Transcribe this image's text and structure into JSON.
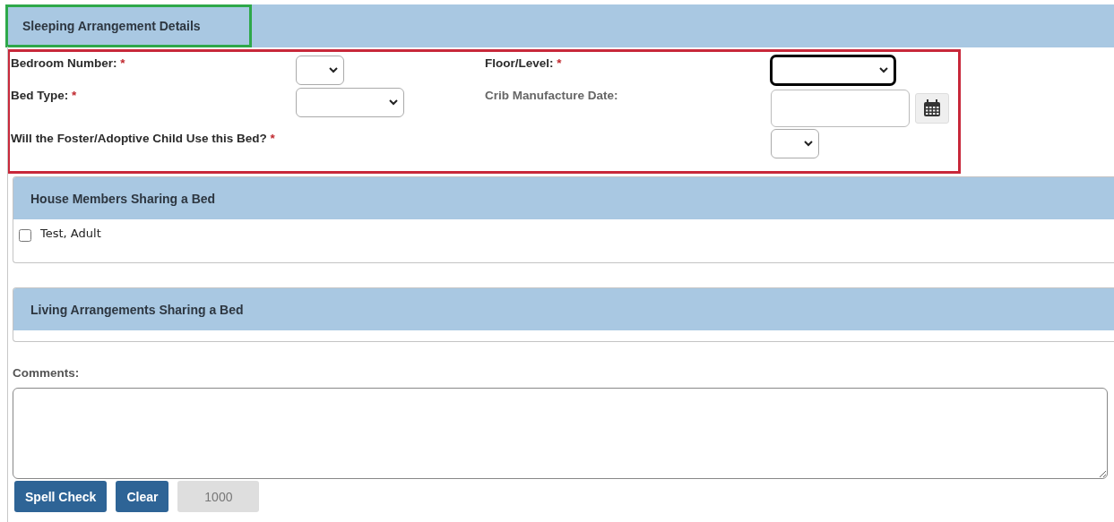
{
  "section": {
    "title": "Sleeping Arrangement Details"
  },
  "fields": [
    {
      "label": "Bedroom Number:",
      "required": true,
      "kind": "select",
      "focused": false
    },
    {
      "label": "Floor/Level:",
      "required": true,
      "kind": "select",
      "focused": true
    },
    {
      "label": "Bed Type:",
      "required": true,
      "kind": "select",
      "focused": false
    },
    {
      "label": "Crib Manufacture Date:",
      "required": false,
      "kind": "date",
      "focused": false
    },
    {
      "label": "Will the Foster/Adoptive Child Use this Bed?",
      "required": true,
      "kind": "select",
      "focused": false
    }
  ],
  "required_mark": "*",
  "house_members": {
    "title": "House Members Sharing a Bed",
    "items": [
      {
        "label": "Test, Adult",
        "checked": false
      }
    ]
  },
  "living_arrangements": {
    "title": "Living Arrangements Sharing a Bed"
  },
  "comments": {
    "label": "Comments:",
    "buttons": [
      "Spell Check",
      "Clear"
    ],
    "counter": "1000"
  }
}
